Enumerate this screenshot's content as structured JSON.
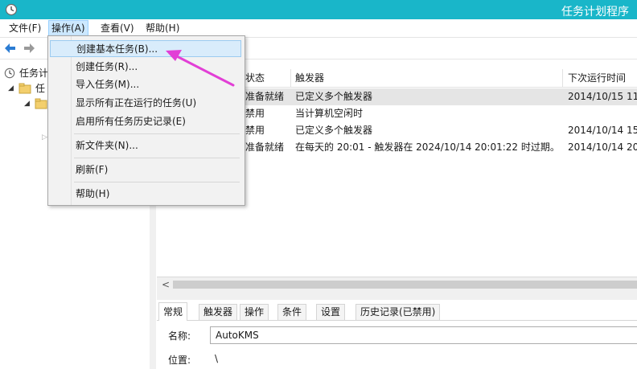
{
  "window": {
    "title": "任务计划程序"
  },
  "menubar": {
    "file": "文件(F)",
    "action": "操作(A)",
    "view": "查看(V)",
    "help": "帮助(H)"
  },
  "dropdown": {
    "items": [
      "创建基本任务(B)...",
      "创建任务(R)...",
      "导入任务(M)...",
      "显示所有正在运行的任务(U)",
      "启用所有任务历史记录(E)",
      "新文件夹(N)...",
      "刷新(F)",
      "帮助(H)"
    ]
  },
  "tree": {
    "root": "任务计",
    "child": "任"
  },
  "tasklist": {
    "columns": [
      "状态",
      "触发器",
      "下次运行时间"
    ],
    "rows": [
      {
        "status": "准备就绪",
        "trigger": "已定义多个触发器",
        "next": "2014/10/15 11"
      },
      {
        "status": "禁用",
        "trigger": "当计算机空闲时",
        "next": ""
      },
      {
        "status": "禁用",
        "trigger": "已定义多个触发器",
        "next": "2014/10/14 15"
      },
      {
        "status": "准备就绪",
        "trigger": "在每天的 20:01 - 触发器在 2024/10/14 20:01:22 时过期。",
        "next": "2014/10/14 20"
      }
    ]
  },
  "details": {
    "tabs": [
      "常规",
      "触发器",
      "操作",
      "条件",
      "设置",
      "历史记录(已禁用)"
    ],
    "name_label": "名称:",
    "name_value": "AutoKMS",
    "location_label": "位置:",
    "location_value": "\\"
  },
  "colors": {
    "titlebar": "#19b6c9",
    "annotation_arrow": "#e23fd6"
  }
}
